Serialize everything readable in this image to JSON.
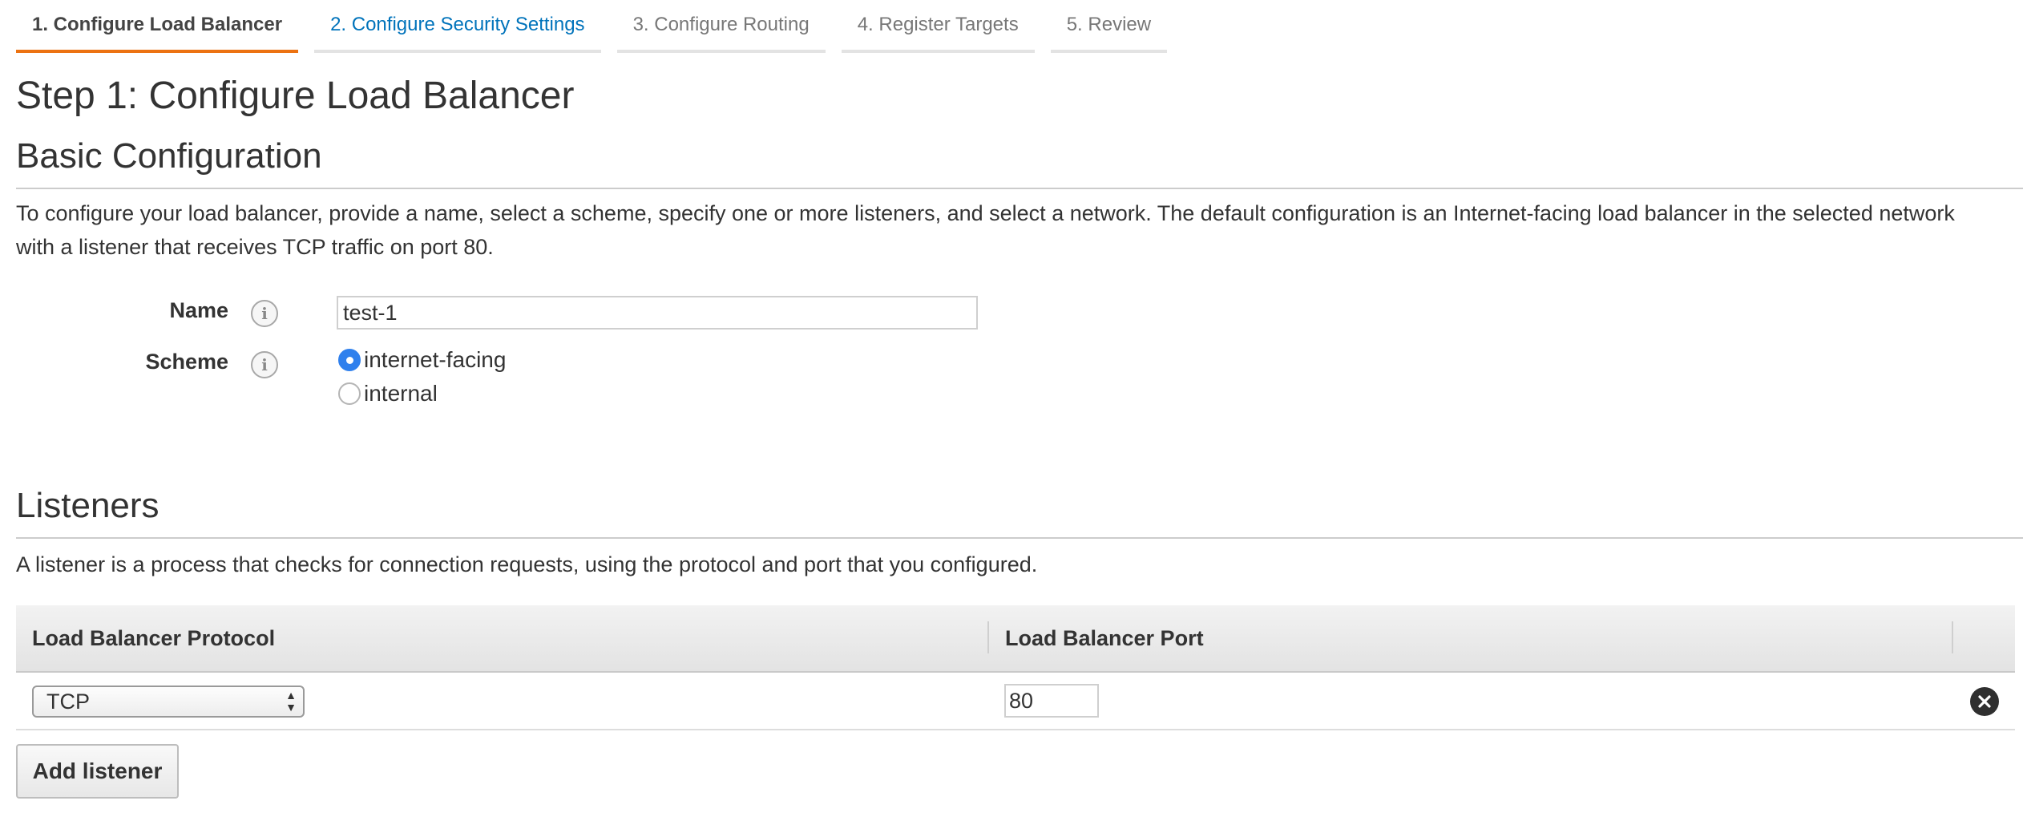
{
  "wizard": {
    "tabs": [
      {
        "label": "1. Configure Load Balancer",
        "state": "active"
      },
      {
        "label": "2. Configure Security Settings",
        "state": "next"
      },
      {
        "label": "3. Configure Routing",
        "state": "disabled"
      },
      {
        "label": "4. Register Targets",
        "state": "disabled"
      },
      {
        "label": "5. Review",
        "state": "disabled"
      }
    ]
  },
  "page": {
    "title": "Step 1: Configure Load Balancer"
  },
  "basic": {
    "heading": "Basic Configuration",
    "description": "To configure your load balancer, provide a name, select a scheme, specify one or more listeners, and select a network. The default configuration is an Internet-facing load balancer in the selected network with a listener that receives TCP traffic on port 80.",
    "name_label": "Name",
    "name_value": "test-1",
    "scheme_label": "Scheme",
    "info_glyph": "i",
    "scheme_options": [
      {
        "label": "internet-facing",
        "checked": true
      },
      {
        "label": "internal",
        "checked": false
      }
    ]
  },
  "listeners": {
    "heading": "Listeners",
    "description": "A listener is a process that checks for connection requests, using the protocol and port that you configured.",
    "columns": [
      "Load Balancer Protocol",
      "Load Balancer Port"
    ],
    "rows": [
      {
        "protocol": "TCP",
        "port": "80"
      }
    ],
    "add_button": "Add listener"
  },
  "colors": {
    "active_tab_underline": "#ec7211",
    "link_blue": "#0073bb",
    "radio_checked": "#2f80ed"
  },
  "icons": {
    "info": "info-icon",
    "remove": "remove-circle-icon",
    "select_arrows": "updown-arrows-icon"
  }
}
